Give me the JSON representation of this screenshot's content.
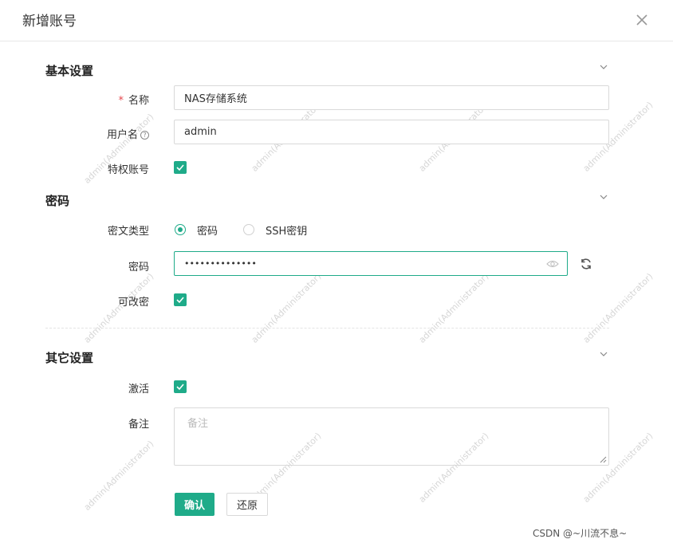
{
  "dialog": {
    "title": "新增账号"
  },
  "sections": {
    "basic": {
      "title": "基本设置"
    },
    "password": {
      "title": "密码"
    },
    "other": {
      "title": "其它设置"
    }
  },
  "fields": {
    "name": {
      "required_mark": "*",
      "label": "名称",
      "value": "NAS存储系统"
    },
    "username": {
      "label": "用户名",
      "help_glyph": "?",
      "value": "admin"
    },
    "privileged": {
      "label": "特权账号",
      "checked": true
    },
    "cipher_type": {
      "label": "密文类型",
      "options": [
        "密码",
        "SSH密钥"
      ],
      "selected": "密码"
    },
    "password": {
      "label": "密码",
      "value": "••••••••••••••"
    },
    "changeable": {
      "label": "可改密",
      "checked": true
    },
    "active": {
      "label": "激活",
      "checked": true
    },
    "remark": {
      "label": "备注",
      "placeholder": "备注"
    }
  },
  "buttons": {
    "confirm": "确认",
    "reset": "还原"
  },
  "watermark": {
    "text": "admin(Administrator)"
  },
  "footer": {
    "credit": "CSDN @~川流不息~"
  },
  "colors": {
    "accent": "#1fab89",
    "required": "#e5484d"
  },
  "icons": [
    "close-icon",
    "chevron-down-icon",
    "help-icon",
    "eye-icon",
    "refresh-icon",
    "check-icon",
    "resize-handle-icon"
  ]
}
